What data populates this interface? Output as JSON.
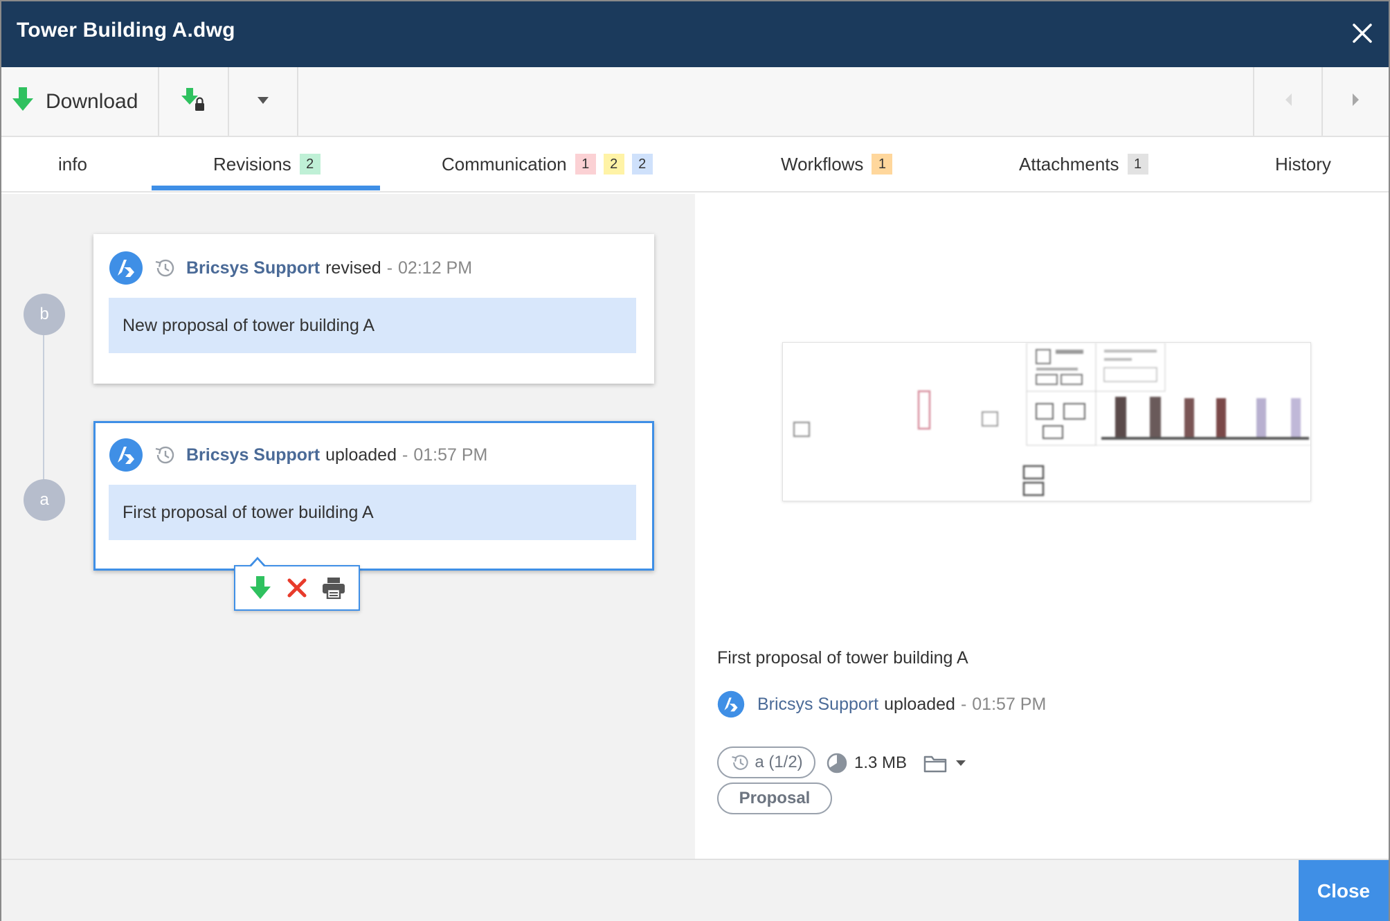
{
  "window": {
    "title": "Tower Building A.dwg"
  },
  "toolbar": {
    "download_label": "Download"
  },
  "tabs": [
    {
      "label": "info"
    },
    {
      "label": "Revisions",
      "badges": [
        {
          "text": "2",
          "color": "#bff0d6"
        }
      ]
    },
    {
      "label": "Communication",
      "badges": [
        {
          "text": "1",
          "color": "#fbd1d4"
        },
        {
          "text": "2",
          "color": "#fff3a6"
        },
        {
          "text": "2",
          "color": "#cfe1fb"
        }
      ]
    },
    {
      "label": "Workflows",
      "badges": [
        {
          "text": "1",
          "color": "#ffd79c"
        }
      ]
    },
    {
      "label": "Attachments",
      "badges": [
        {
          "text": "1",
          "color": "#e2e2e2"
        }
      ]
    },
    {
      "label": "History"
    }
  ],
  "active_tab": "Revisions",
  "revisions": [
    {
      "node": "b",
      "author": "Bricsys Support",
      "action": "revised",
      "separator": "-",
      "time": "02:12 PM",
      "message": "New proposal of tower building A",
      "selected": false
    },
    {
      "node": "a",
      "author": "Bricsys Support",
      "action": "uploaded",
      "separator": "-",
      "time": "01:57 PM",
      "message": "First proposal of tower building A",
      "selected": true
    }
  ],
  "popup_actions": [
    "download-icon",
    "delete-icon",
    "print-icon"
  ],
  "details": {
    "description": "First proposal of tower building A",
    "author": "Bricsys Support",
    "action": "uploaded",
    "separator": "-",
    "time": "01:57 PM",
    "revision": "a (1/2)",
    "size": "1.3 MB",
    "tag": "Proposal"
  },
  "footer": {
    "close_label": "Close"
  },
  "colors": {
    "titlebar": "#1b3a5c",
    "accent": "#3f8fe6",
    "link": "#4a6a97",
    "message_bg": "#d8e7fb",
    "download_green": "#2fc15f",
    "delete_red": "#e83b2b"
  }
}
